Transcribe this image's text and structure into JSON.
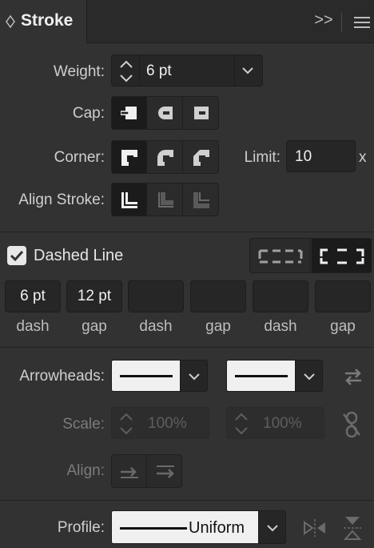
{
  "panel": {
    "title": "Stroke",
    "expand_icon": ">>",
    "menu_icon": "menu-icon"
  },
  "weight": {
    "label": "Weight:",
    "value": "6 pt"
  },
  "cap": {
    "label": "Cap:"
  },
  "corner": {
    "label": "Corner:",
    "limit_label": "Limit:",
    "limit_value": "10",
    "limit_unit": "x"
  },
  "align_stroke": {
    "label": "Align Stroke:"
  },
  "dashed": {
    "label": "Dashed Line",
    "checked": true,
    "fields": [
      {
        "value": "6 pt",
        "label": "dash"
      },
      {
        "value": "12 pt",
        "label": "gap"
      },
      {
        "value": "",
        "label": "dash"
      },
      {
        "value": "",
        "label": "gap"
      },
      {
        "value": "",
        "label": "dash"
      },
      {
        "value": "",
        "label": "gap"
      }
    ]
  },
  "arrowheads": {
    "label": "Arrowheads:"
  },
  "scale": {
    "label": "Scale:",
    "start": "100%",
    "end": "100%"
  },
  "align": {
    "label": "Align:"
  },
  "profile": {
    "label": "Profile:",
    "value": "Uniform"
  },
  "colors": {
    "panel_bg": "#323232",
    "field_bg": "#262626",
    "text": "#d9d9d9"
  }
}
